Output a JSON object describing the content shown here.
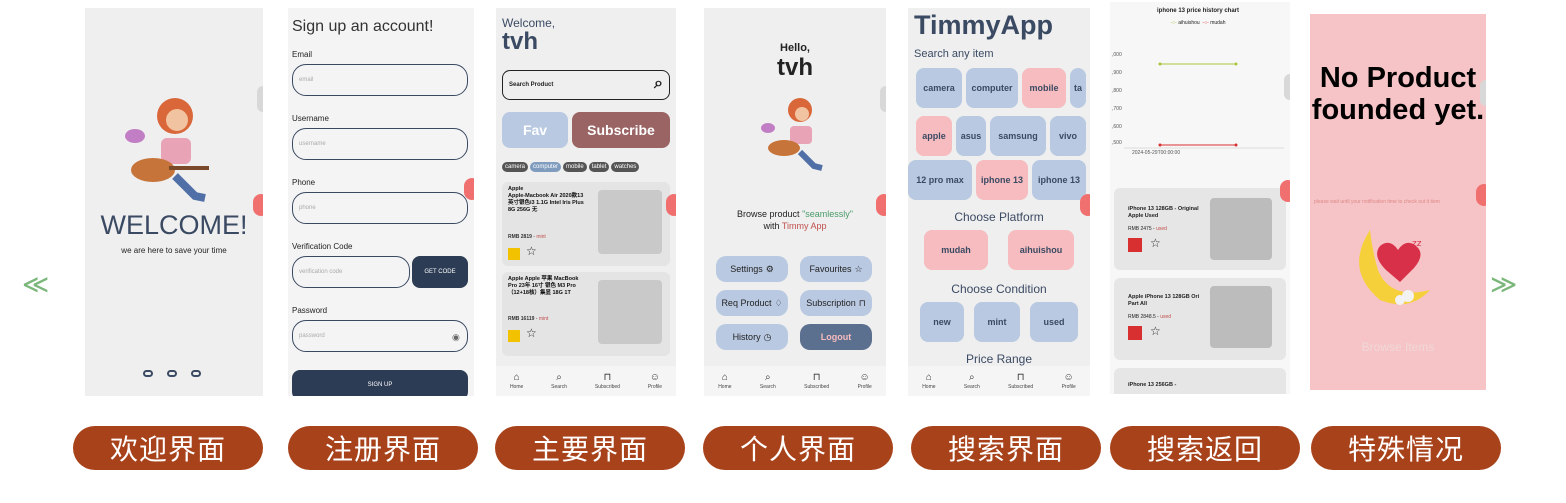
{
  "nav": {
    "prev": "≪",
    "next": "≫"
  },
  "captions": [
    "欢迎界面",
    "注册界面",
    "主要界面",
    "个人界面",
    "搜索界面",
    "搜索返回",
    "特殊情况"
  ],
  "colors": {
    "caption_bg": "#a8421b",
    "navy": "#3b4a63",
    "pink": "#f6bcbf",
    "blue": "#b9c9e2"
  },
  "tabs": [
    "Home",
    "Search",
    "Subscribed",
    "Profile"
  ],
  "welcome": {
    "title": "WELCOME!",
    "subtitle": "we are here to save your time"
  },
  "signup": {
    "title": "Sign up an account!",
    "fields": [
      {
        "label": "Email",
        "placeholder": "email"
      },
      {
        "label": "Username",
        "placeholder": "username"
      },
      {
        "label": "Phone",
        "placeholder": "phone"
      },
      {
        "label": "Verification Code",
        "placeholder": "verification code"
      },
      {
        "label": "Password",
        "placeholder": "password"
      }
    ],
    "get_code": "GET CODE",
    "sign_up": "SIGN UP"
  },
  "main": {
    "welcome": "Welcome,",
    "user": "tvh",
    "search_placeholder": "Search Product",
    "fav": "Fav",
    "subscribe": "Subscribe",
    "chips": [
      "camera",
      "computer",
      "mobile",
      "tablet",
      "watches"
    ],
    "products": [
      {
        "brand": "Apple",
        "name": "Apple-Macbook Air 2020款13英寸银色i3 1.1G Intel Iris Plus 8G 256G 无",
        "price": "RMB 2819",
        "cond": "mint"
      },
      {
        "brand": "Apple",
        "name": "Apple 苹果 MacBook Pro 23年 16寸 银色 M3 Pro（12+18核）集显 18G 1T",
        "price": "RMB 16119",
        "cond": "mint"
      }
    ]
  },
  "profile": {
    "hello": "Hello,",
    "user": "tvh",
    "tag_pre": "Browse product ",
    "tag_green": "\"seamlessly\"",
    "tag_with": "with ",
    "tag_app": "Timmy App",
    "menu": {
      "settings": "Settings",
      "favourites": "Favourites",
      "req_product": "Req Product",
      "subscription": "Subscription",
      "history": "History",
      "logout": "Logout"
    }
  },
  "search": {
    "app": "TimmyApp",
    "search_any": "Search any item",
    "row1": [
      "camera",
      "computer",
      "mobile",
      "ta"
    ],
    "row2": [
      "apple",
      "asus",
      "samsung",
      "vivo"
    ],
    "row3": [
      "12 pro max",
      "iphone 13",
      "iphone 13"
    ],
    "choose_platform": "Choose Platform",
    "platforms": [
      "mudah",
      "aihuishou"
    ],
    "choose_condition": "Choose Condition",
    "conditions": [
      "new",
      "mint",
      "used"
    ],
    "price_range": "Price Range"
  },
  "results": {
    "chart_title": "iphone 13 price history chart",
    "legend": [
      "aihuishou",
      "mudah"
    ],
    "y_labels": [
      ",000",
      ",900",
      ",800",
      ",700",
      ",600",
      ",500"
    ],
    "x_label": "2024-05-29T00:00:00",
    "items": [
      {
        "name": "iPhone 13 128GB - Original Apple Used",
        "price": "RMB 2475",
        "cond": "used"
      },
      {
        "name": "Apple iPhone 13 128GB Ori Part All",
        "price": "RMB 2848.5",
        "cond": "used"
      },
      {
        "name": "iPhone 13 256GB -",
        "price": "",
        "cond": ""
      }
    ]
  },
  "empty": {
    "title": "No Product founded yet.",
    "hint": "please wait until your notification time to check out it item",
    "browse": "Browse Items"
  }
}
